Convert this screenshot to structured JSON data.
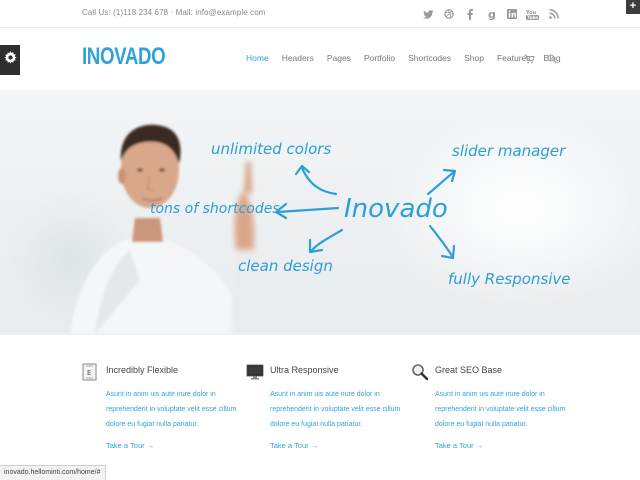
{
  "topbar": {
    "contact": "Call Us: (1)118 234 678 · Mail: info@example.com",
    "socials": [
      {
        "icon": "twitter-icon",
        "glyph": "🐦"
      },
      {
        "icon": "dribbble-icon",
        "glyph": "◎"
      },
      {
        "icon": "facebook-icon",
        "glyph": "f"
      },
      {
        "icon": "google-plus-icon",
        "glyph": "g"
      },
      {
        "icon": "linkedin-icon",
        "glyph": "in"
      },
      {
        "icon": "youtube-icon",
        "glyph": "You"
      },
      {
        "icon": "rss-icon",
        "glyph": "⌇"
      }
    ]
  },
  "header": {
    "logo": "INOVADO",
    "nav": [
      "Home",
      "Headers",
      "Pages",
      "Portfolio",
      "Shortcodes",
      "Shop",
      "Features",
      "Blog"
    ],
    "active": "Home"
  },
  "hero": {
    "center": "Inovado",
    "labels": {
      "top_left": "unlimited colors",
      "left": "tons of shortcodes",
      "bottom_left": "clean design",
      "top_right": "slider manager",
      "bottom_right": "fully Responsive"
    }
  },
  "features": [
    {
      "title": "Incredibly Flexible",
      "icon": "document-icon",
      "body": "Asunt in anim uis aute irure dolor in reprehenderit in voluptate velit esse cillum dolore eu fugiat nulla pariatur.",
      "link": "Take a Tour →"
    },
    {
      "title": "Ultra Responsive",
      "icon": "monitor-icon",
      "body": "Asunt in anim uis aute irure dolor in reprehenderit in voluptate velit esse cillum dolore eu fugiat nulla pariatur.",
      "link": "Take a Tour →"
    },
    {
      "title": "Great SEO Base",
      "icon": "magnifier-icon",
      "body": "Asunt in anim uis aute irure dolor in reprehenderit in voluptate velit esse cillum dolore eu fugiat nulla pariatur.",
      "link": "Take a Tour →"
    }
  ],
  "statusbar": "inovado.hellominti.com/home/#",
  "colors": {
    "accent": "#2ea3da",
    "dark": "#2e2e2e"
  }
}
